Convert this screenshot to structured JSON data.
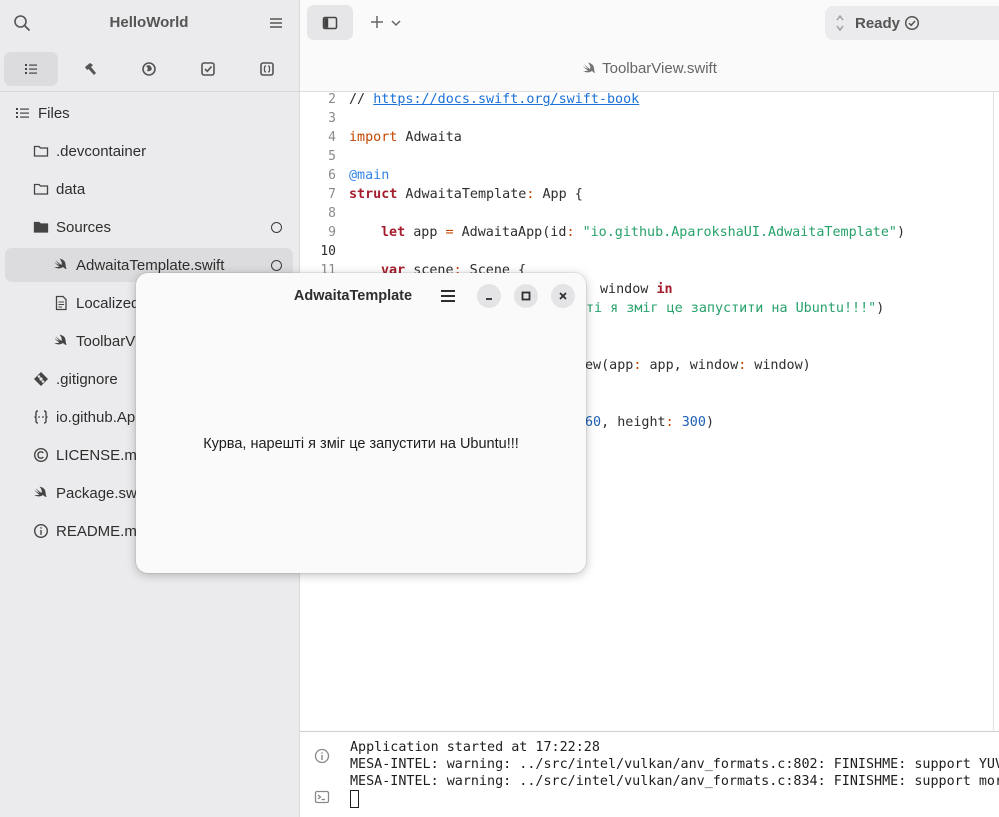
{
  "sidebar": {
    "title": "HelloWorld",
    "tabs": [
      {
        "icon": "list-icon",
        "active": true
      },
      {
        "icon": "hammer-icon",
        "active": false
      },
      {
        "icon": "globe-icon",
        "active": false
      },
      {
        "icon": "checkbox-icon",
        "active": false
      },
      {
        "icon": "braces-doc-icon",
        "active": false
      }
    ],
    "tree": [
      {
        "label": "Files",
        "icon": "list-icon",
        "indent": 0
      },
      {
        "label": ".devcontainer",
        "icon": "folder-icon",
        "indent": 1
      },
      {
        "label": "data",
        "icon": "folder-icon",
        "indent": 1
      },
      {
        "label": "Sources",
        "icon": "folder-open-icon",
        "indent": 1,
        "modified": true
      },
      {
        "label": "AdwaitaTemplate.swift",
        "icon": "swift-icon",
        "indent": 2,
        "modified": true,
        "selected": true
      },
      {
        "label": "Localized",
        "icon": "document-icon",
        "indent": 2
      },
      {
        "label": "ToolbarV",
        "icon": "swift-icon",
        "indent": 2
      },
      {
        "label": ".gitignore",
        "icon": "git-icon",
        "indent": 1
      },
      {
        "label": "io.github.Ap",
        "icon": "braces-icon",
        "indent": 1
      },
      {
        "label": "LICENSE.md",
        "icon": "copyright-icon",
        "indent": 1
      },
      {
        "label": "Package.swi",
        "icon": "swift-icon",
        "indent": 1
      },
      {
        "label": "README.mc",
        "icon": "info-icon",
        "indent": 1
      }
    ]
  },
  "toolbar": {
    "status": "Ready"
  },
  "editor": {
    "tab_title": "ToolbarView.swift",
    "line_numbers": [
      "2",
      "3",
      "4",
      "5",
      "6",
      "7",
      "8",
      "9",
      "10",
      "11"
    ],
    "current_line": "10",
    "code": {
      "l2_comment": "// ",
      "l2_link": "https://docs.swift.org/swift-book",
      "l4_kw": "import",
      "l4_rest": " Adwaita",
      "l6": "@main",
      "l7_kw": "struct",
      "l7_name": " AdwaitaTemplate",
      "l7_colon": ":",
      "l7_rest": " App {",
      "l9_kw": "let",
      "l9_a": " app ",
      "l9_eq": "=",
      "l9_b": " AdwaitaApp(id",
      "l9_colon": ":",
      "l9_c": " ",
      "l9_str": "\"io.github.AparokshaUI.AdwaitaTemplate\"",
      "l9_d": ")",
      "l11_kw": "var",
      "l11_a": " scene",
      "l11_colon": ":",
      "l11_b": " Scene {",
      "l12_a": "window ",
      "l12_kw": "in",
      "l13_str": "ті я зміг це запустити на Ubuntu!!!\"",
      "l13_end": ")",
      "l15_a": "ew(app",
      "l15_c1": ":",
      "l15_b": " app, window",
      "l15_c2": ":",
      "l15_c": " window)",
      "l17_num1": "60",
      "l17_a": ", height",
      "l17_c": ":",
      "l17_b": " ",
      "l17_num2": "300",
      "l17_end": ")"
    }
  },
  "console": {
    "lines": [
      "Application started at 17:22:28",
      "MESA-INTEL: warning: ../src/intel/vulkan/anv_formats.c:802: FINISHME: support YUV",
      "MESA-INTEL: warning: ../src/intel/vulkan/anv_formats.c:834: FINISHME: support mor"
    ]
  },
  "app_window": {
    "title": "AdwaitaTemplate",
    "message": "Курва, нарешті я зміг це запустити на Ubuntu!!!"
  }
}
